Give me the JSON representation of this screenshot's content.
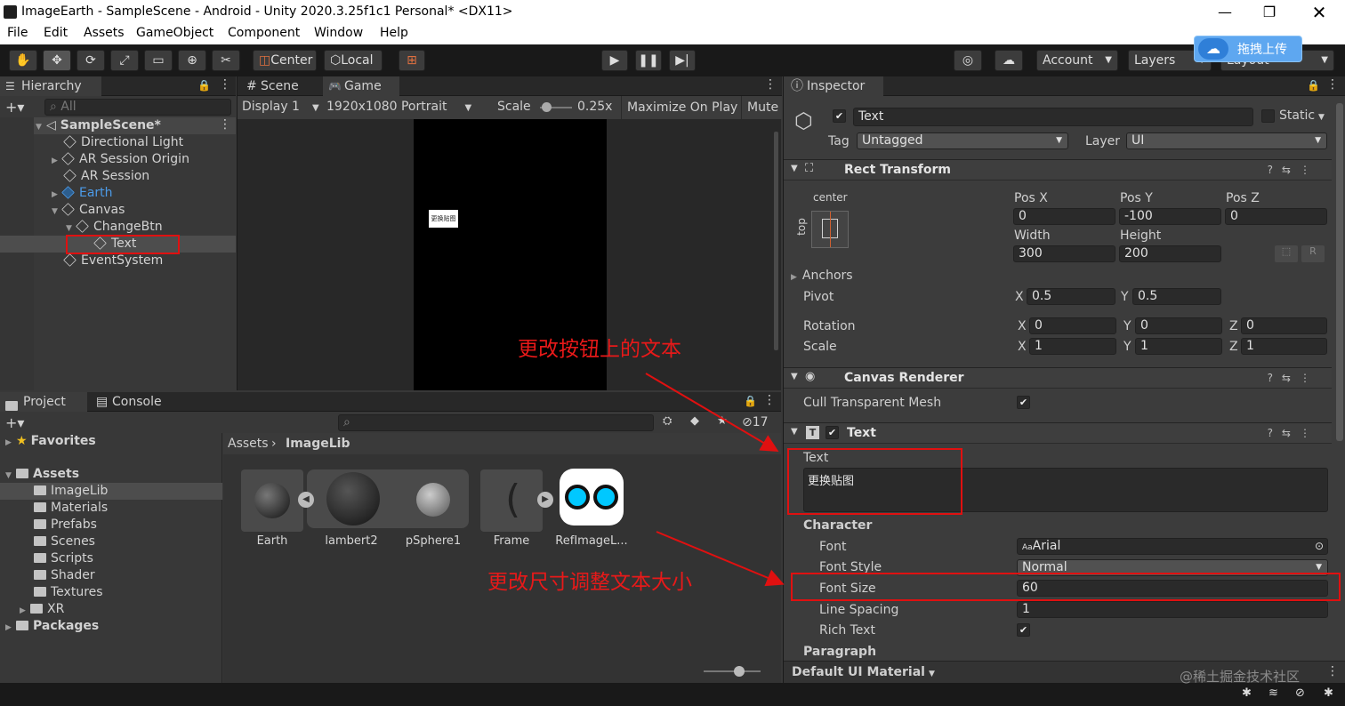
{
  "window": {
    "title": "ImageEarth - SampleScene - Android - Unity 2020.3.25f1c1 Personal* <DX11>"
  },
  "menu": [
    "File",
    "Edit",
    "Assets",
    "GameObject",
    "Component",
    "Window",
    "Help"
  ],
  "toolbar": {
    "pivot": "Center",
    "space": "Local",
    "account": "Account",
    "layers": "Layers",
    "layout": "Layout",
    "upload_badge": "拖拽上传"
  },
  "hierarchy": {
    "tab": "Hierarchy",
    "search_placeholder": "All",
    "items": [
      {
        "label": "SampleScene*",
        "depth": 0
      },
      {
        "label": "Directional Light",
        "depth": 1
      },
      {
        "label": "AR Session Origin",
        "depth": 1
      },
      {
        "label": "AR Session",
        "depth": 1
      },
      {
        "label": "Earth",
        "depth": 1
      },
      {
        "label": "Canvas",
        "depth": 1
      },
      {
        "label": "ChangeBtn",
        "depth": 2
      },
      {
        "label": "Text",
        "depth": 3
      },
      {
        "label": "EventSystem",
        "depth": 1
      }
    ]
  },
  "game": {
    "tab_scene": "Scene",
    "tab_game": "Game",
    "display": "Display 1",
    "resolution": "1920x1080 Portrait",
    "scale_label": "Scale",
    "scale_value": "0.25x",
    "maximize": "Maximize On Play",
    "mute": "Mute",
    "button_text": "更换贴图"
  },
  "project": {
    "tab_project": "Project",
    "tab_console": "Console",
    "hidden_count": "17",
    "tree": [
      {
        "label": "Favorites",
        "kind": "star"
      },
      {
        "label": "Assets",
        "kind": "root"
      },
      {
        "label": "ImageLib",
        "kind": "folder"
      },
      {
        "label": "Materials",
        "kind": "folder"
      },
      {
        "label": "Prefabs",
        "kind": "folder"
      },
      {
        "label": "Scenes",
        "kind": "folder"
      },
      {
        "label": "Scripts",
        "kind": "folder"
      },
      {
        "label": "Shader",
        "kind": "folder"
      },
      {
        "label": "Textures",
        "kind": "folder"
      },
      {
        "label": "XR",
        "kind": "folder"
      },
      {
        "label": "Packages",
        "kind": "root"
      }
    ],
    "breadcrumb": [
      "Assets",
      "ImageLib"
    ],
    "assets": [
      "Earth",
      "lambert2",
      "pSphere1",
      "Frame",
      "RefImageL..."
    ]
  },
  "inspector": {
    "tab": "Inspector",
    "object_name": "Text",
    "static_label": "Static",
    "tag_label": "Tag",
    "tag_value": "Untagged",
    "layer_label": "Layer",
    "layer_value": "UI",
    "rect": {
      "title": "Rect Transform",
      "anchor_h": "center",
      "anchor_v": "top",
      "posx_label": "Pos X",
      "posy_label": "Pos Y",
      "posz_label": "Pos Z",
      "posx": "0",
      "posy": "-100",
      "posz": "0",
      "width_label": "Width",
      "height_label": "Height",
      "width": "300",
      "height": "200",
      "anchors": "Anchors",
      "pivot": "Pivot",
      "pivot_x": "0.5",
      "pivot_y": "0.5",
      "rotation": "Rotation",
      "rot_x": "0",
      "rot_y": "0",
      "rot_z": "0",
      "scale": "Scale",
      "scale_x": "1",
      "scale_y": "1",
      "scale_z": "1",
      "x": "X",
      "y": "Y",
      "z": "Z"
    },
    "canvas_renderer": {
      "title": "Canvas Renderer",
      "cull": "Cull Transparent Mesh"
    },
    "text": {
      "title": "Text",
      "text_label": "Text",
      "text_value": "更换贴图",
      "character": "Character",
      "font_label": "Font",
      "font_value": "Arial",
      "font_style_label": "Font Style",
      "font_style_value": "Normal",
      "font_size_label": "Font Size",
      "font_size_value": "60",
      "line_spacing_label": "Line Spacing",
      "line_spacing_value": "1",
      "rich_text_label": "Rich Text",
      "paragraph": "Paragraph"
    },
    "material": "Default UI Material"
  },
  "annotations": {
    "note1": "更改按钮上的文本",
    "note2": "更改尺寸调整文本大小",
    "watermark": "@稀土掘金技术社区"
  },
  "colors": {
    "highlight": "#e01010",
    "selection": "#2c5d87",
    "earth_text": "#4c9be8"
  }
}
